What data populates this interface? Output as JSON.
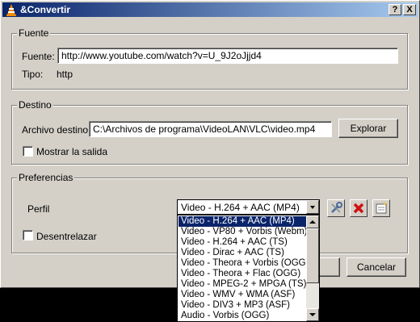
{
  "window": {
    "title": "&Convertir",
    "help_btn": "?",
    "close_btn": "X"
  },
  "source": {
    "legend": "Fuente",
    "label": "Fuente:",
    "value": "http://www.youtube.com/watch?v=U_9J2oJjjd4",
    "type_label": "Tipo:",
    "type_value": "http"
  },
  "destination": {
    "legend": "Destino",
    "label": "Archivo destino:",
    "value": "C:\\Archivos de programa\\VideoLAN\\VLC\\video.mp4",
    "browse_label": "Explorar",
    "show_output_label": "Mostrar la salida",
    "show_output_checked": false
  },
  "preferences": {
    "legend": "Preferencias",
    "profile_label": "Perfil",
    "profile_selected": "Video - H.264 + AAC (MP4)",
    "deinterlace_label": "Desentrelazar",
    "deinterlace_checked": false,
    "profile_options": [
      "Video - H.264 + AAC (MP4)",
      "Video - VP80 + Vorbis (Webm)",
      "Video - H.264 + AAC (TS)",
      "Video - Dirac + AAC (TS)",
      "Video - Theora + Vorbis (OGG)",
      "Video - Theora + Flac (OGG)",
      "Video - MPEG-2 + MPGA (TS)",
      "Video - WMV + WMA (ASF)",
      "Video - DIV3 + MP3 (ASF)",
      "Audio - Vorbis (OGG)"
    ],
    "highlighted_index": 0
  },
  "footer": {
    "cancel_label": "Cancelar"
  },
  "icons": {
    "edit_profile": "wrench-icon",
    "delete_profile": "delete-icon",
    "new_profile": "new-profile-icon"
  }
}
